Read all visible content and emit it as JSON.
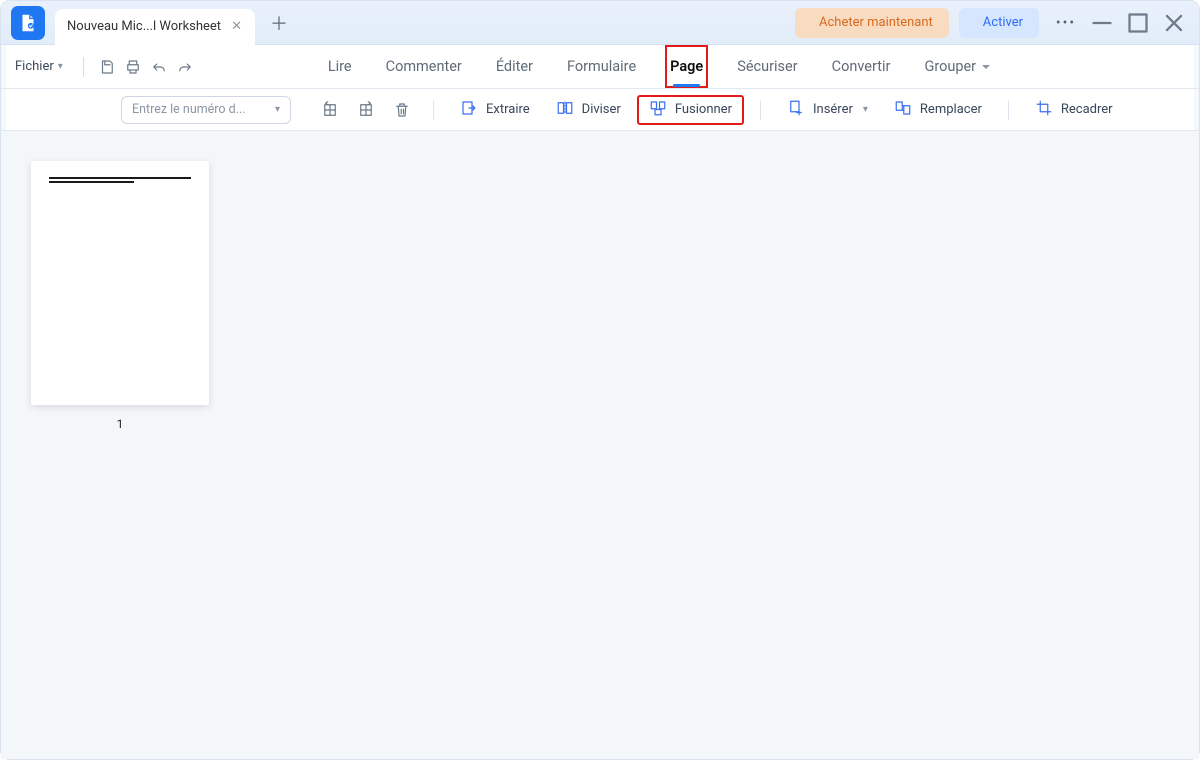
{
  "titlebar": {
    "tab_title": "Nouveau Mic...l Worksheet",
    "buy_label": "Acheter maintenant",
    "activate_label": "Activer"
  },
  "menubar": {
    "file": "Fichier",
    "items": [
      "Lire",
      "Commenter",
      "Éditer",
      "Formulaire",
      "Page",
      "Sécuriser",
      "Convertir",
      "Grouper"
    ],
    "active_index": 4,
    "dropdown_index": 7
  },
  "toolbar": {
    "page_input_placeholder": "Entrez le numéro d...",
    "extract": "Extraire",
    "split": "Diviser",
    "merge": "Fusionner",
    "insert": "Insérer",
    "replace": "Remplacer",
    "crop": "Recadrer"
  },
  "page": {
    "thumb_number": "1"
  },
  "highlights": {
    "menu": "Page",
    "tool": "Fusionner"
  }
}
